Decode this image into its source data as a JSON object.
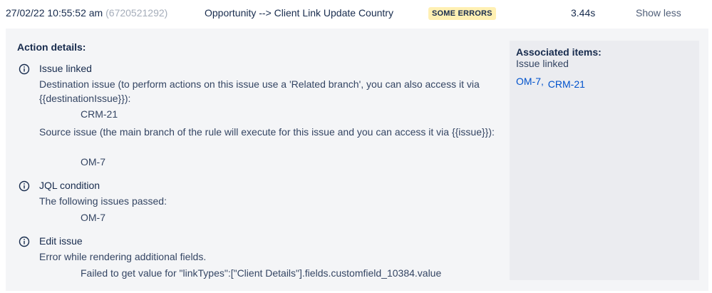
{
  "header": {
    "timestamp": "27/02/22 10:55:52 am",
    "execution_id": "(6720521292)",
    "rule_name": "Opportunity --> Client Link Update Country",
    "status": "SOME ERRORS",
    "duration": "3.44s",
    "toggle_label": "Show less"
  },
  "details": {
    "title": "Action details:",
    "actions": [
      {
        "name": "Issue linked",
        "text1": "Destination issue (to perform actions on this issue use a 'Related branch', you can also access it via {{destinationIssue}}):",
        "value1": "CRM-21",
        "text2": "Source issue (the main branch of the rule will execute for this issue and you can access it via {{issue}}):",
        "value2": "OM-7"
      },
      {
        "name": "JQL condition",
        "text1": "The following issues passed:",
        "value1": "OM-7"
      },
      {
        "name": "Edit issue",
        "text1": "Error while rendering additional fields.",
        "value1": "Failed to get value for \"linkTypes\":[\"Client Details\"].fields.customfield_10384.value"
      }
    ]
  },
  "associated": {
    "title": "Associated items:",
    "subtitle": "Issue linked",
    "links": [
      "OM-7,",
      "CRM-21"
    ]
  },
  "icons": {
    "info": "info-circle-icon"
  },
  "colors": {
    "status_bg": "#fff0b3",
    "link": "#0052cc",
    "panel": "#f4f5f7",
    "assoc_panel": "#ebecf0"
  }
}
